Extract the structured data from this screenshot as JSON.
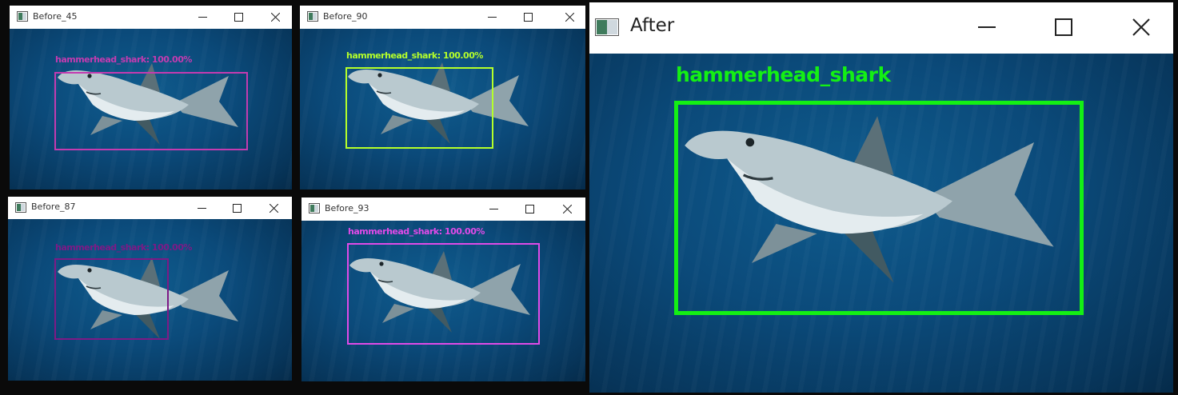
{
  "windows": {
    "before_45": {
      "title": "Before_45",
      "label": "hammerhead_shark: 100.00%",
      "color": "#c43bb0"
    },
    "before_90": {
      "title": "Before_90",
      "label": "hammerhead_shark: 100.00%",
      "color": "#b5ff2a"
    },
    "before_87": {
      "title": "Before_87",
      "label": "hammerhead_shark: 100.00%",
      "color": "#7d1a86"
    },
    "before_93": {
      "title": "Before_93",
      "label": "hammerhead_shark: 100.00%",
      "color": "#e04ae8"
    },
    "after": {
      "title": "After",
      "label": "hammerhead_shark",
      "color": "#14f014"
    }
  },
  "icons": {
    "minimize": "minimize-icon",
    "maximize": "maximize-icon",
    "close": "close-icon",
    "app": "app-window-icon"
  }
}
